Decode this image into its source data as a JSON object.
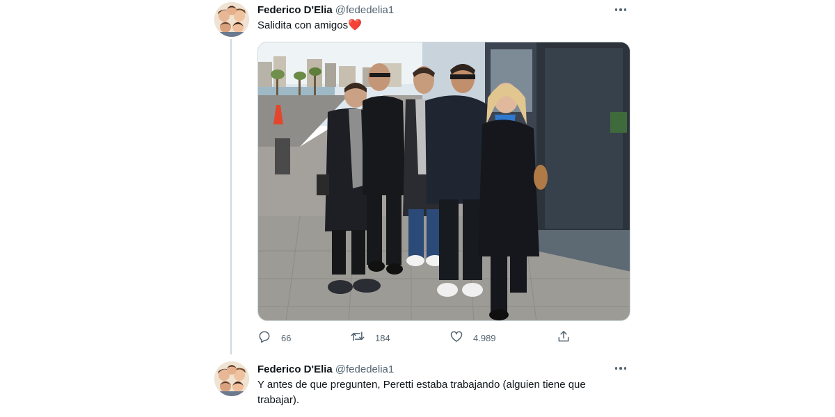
{
  "tweets": [
    {
      "author_name": "Federico D'Elia",
      "author_handle": "@fededelia1",
      "text": "Salidita con amigos",
      "emoji": "❤️",
      "stats": {
        "replies": "66",
        "retweets": "184",
        "likes": "4.989"
      }
    },
    {
      "author_name": "Federico D'Elia",
      "author_handle": "@fededelia1",
      "text": "Y antes de que pregunten, Peretti estaba trabajando (alguien tiene que trabajar)."
    }
  ],
  "icons": {
    "more": "more-horizontal-icon",
    "reply": "reply-icon",
    "retweet": "retweet-icon",
    "like": "like-heart-icon",
    "share": "share-icon"
  },
  "colors": {
    "text_primary": "#0f1419",
    "text_secondary": "#536471",
    "border": "#cfd9de",
    "heart": "#e0245e"
  }
}
